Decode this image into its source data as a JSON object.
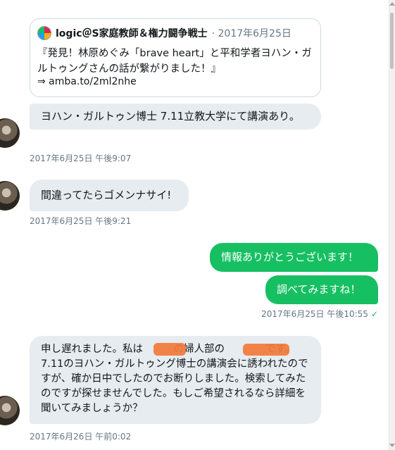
{
  "quote": {
    "name": "logic＠S家庭教師＆権力闘争戦士",
    "date": "· 2017年6月25日",
    "text": "『発見！林原めぐみ「brave heart」と平和学者ヨハン・ガルトゥングさんの話が繋がりました！』",
    "link": "⇒ amba.to/2ml2nhe"
  },
  "messages": [
    {
      "side": "received",
      "text": "ヨハン・ガルトゥン博士 7.11立教大学にて講演あり。",
      "time": "2017年6月25日 午後9:07"
    },
    {
      "side": "received",
      "text": "間違ってたらゴメンナサイ!",
      "time": "2017年6月25日 午後9:21"
    },
    {
      "side": "sent",
      "text": "情報ありがとうございます！"
    },
    {
      "side": "sent",
      "text": "調べてみますね！",
      "time": "2017年6月25日 午後10:55",
      "status_icon": "checkmark-icon"
    },
    {
      "side": "received",
      "text": "申し遅れました。私は　　　の婦人部の　　　　です。7.11のヨハン・ガルトゥング博士の講演会に誘われたのですが、確か日中でしたのでお断りしました。検索してみたのですが探せませんでした。もしご希望されるなら詳細を聞いてみましょうか？",
      "time": "2017年6月26日 午前0:02"
    }
  ],
  "colors": {
    "sent_bubble": "#17bf63",
    "received_bubble": "#e6ecf0",
    "timestamp": "#657786",
    "redaction": "#f27a3b"
  },
  "labels": {
    "check": "✓"
  }
}
